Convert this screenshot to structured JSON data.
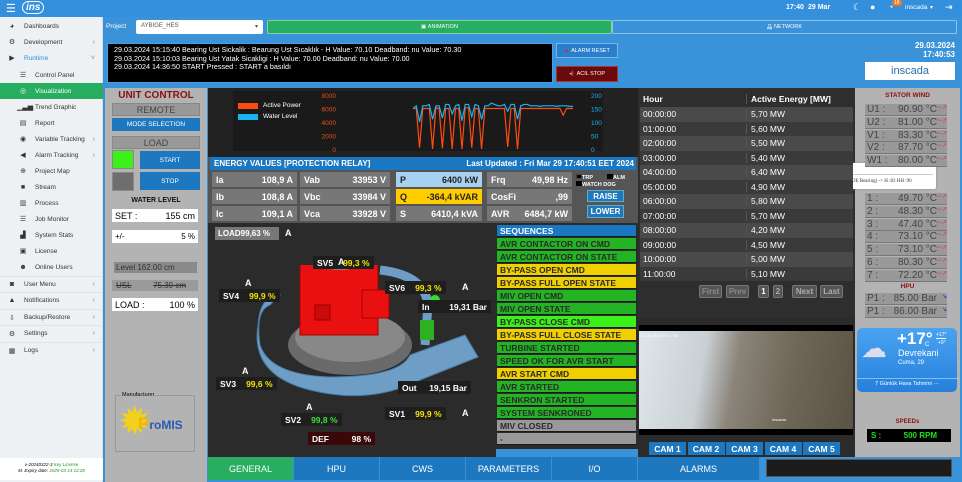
{
  "topbar": {
    "time": "17:40",
    "date": "29 Mar",
    "notif_count": "18",
    "user": "inscada"
  },
  "sidebar": {
    "items": [
      {
        "label": "Dashboards",
        "icon": "dashboard-icon",
        "glyph": "◕"
      },
      {
        "label": "Development",
        "icon": "development-icon",
        "glyph": "⚙",
        "chev": "‹"
      },
      {
        "label": "Runtime",
        "icon": "runtime-icon",
        "glyph": "▶",
        "chev": "˅"
      },
      {
        "label": "Control Panel",
        "icon": "control-panel-icon",
        "glyph": "☰",
        "sub": true
      },
      {
        "label": "Visualization",
        "icon": "visualization-icon",
        "glyph": "◎",
        "sub": true,
        "active": true
      },
      {
        "label": "Trend Graphic",
        "icon": "trend-icon",
        "glyph": "▁▃▅",
        "sub": true
      },
      {
        "label": "Report",
        "icon": "report-icon",
        "glyph": "▤",
        "sub": true
      },
      {
        "label": "Variable Tracking",
        "icon": "eye-icon",
        "glyph": "◉",
        "sub": true,
        "chev": "‹"
      },
      {
        "label": "Alarm Tracking",
        "icon": "megaphone-icon",
        "glyph": "◀",
        "sub": true,
        "chev": "‹"
      },
      {
        "label": "Project Map",
        "icon": "globe-icon",
        "glyph": "⊕",
        "sub": true
      },
      {
        "label": "Stream",
        "icon": "video-icon",
        "glyph": "■",
        "sub": true
      },
      {
        "label": "Process",
        "icon": "process-icon",
        "glyph": "▥",
        "sub": true
      },
      {
        "label": "Job Monitor",
        "icon": "job-monitor-icon",
        "glyph": "☰",
        "sub": true
      },
      {
        "label": "System Stats",
        "icon": "stats-icon",
        "glyph": "▟",
        "sub": true
      },
      {
        "label": "License",
        "icon": "license-icon",
        "glyph": "▣",
        "sub": true
      },
      {
        "label": "Online Users",
        "icon": "users-icon",
        "glyph": "☻",
        "sub": true
      },
      {
        "label": "User Menu",
        "icon": "user-icon",
        "glyph": "◙",
        "chev": "‹"
      },
      {
        "label": "Notifications",
        "icon": "bell-icon",
        "glyph": "▲",
        "chev": "‹"
      },
      {
        "label": "Backup/Restore",
        "icon": "download-icon",
        "glyph": "⇩",
        "chev": "‹"
      },
      {
        "label": "Settings",
        "icon": "gears-icon",
        "glyph": "⚙",
        "chev": "‹"
      },
      {
        "label": "Logs",
        "icon": "book-icon",
        "glyph": "▦",
        "chev": "‹"
      }
    ],
    "footer": {
      "version": "v-20240322-3",
      "key": "Key License",
      "expiry_label": "M. Expiry date:",
      "expiry": "2025-03-14 12:28"
    }
  },
  "project": {
    "label": "Project",
    "value": "AYBIGE_HES",
    "animation": "ANIMATION",
    "network": "NETWORK"
  },
  "alarms": {
    "lines": [
      "29.03.2024 15:15:40 Bearing Ust Sickalik : Bearung Ust Sıcaklık - H Value: 70.10  Deadband: nu  Value: 70.30",
      "29.03.2024 15:10:03 Bearing Ust Yatak Sicakligi : H Value: 70.00  Deadband: nu  Value: 70.00",
      "29.03.2024 14:36:50 START Pressed : START a basıldı"
    ],
    "reset": "ALARM RESET",
    "stop": "ACIL STOP"
  },
  "clock": {
    "date": "29.03.2024",
    "time": "17:40:53",
    "logo": "inscada"
  },
  "unit_control": {
    "title": "UNIT CONTROL",
    "remote": "REMOTE",
    "mode": "MODE SELECTION",
    "load": "LOAD",
    "start": "START",
    "stop": "STOP",
    "water_title": "WATER LEVEL",
    "set_label": "SET :",
    "set_value": "155 cm",
    "pm_label": "+/-",
    "pm_value": "5 %",
    "level": "Level 162.00  cm",
    "usl_label": "USL",
    "usl_value": "75.39 cm",
    "load_label": "LOAD :",
    "load_value": "100 %",
    "manufacturer": "Manufacturer",
    "maker_logo": "ProMIS"
  },
  "trend": {
    "legend": [
      "Active Power",
      "Water Level"
    ],
    "colors": [
      "#ff4a10",
      "#1ab4f0"
    ],
    "left_ticks": [
      "8000",
      "6000",
      "4000",
      "2000",
      "0"
    ],
    "right_ticks": [
      "200",
      "150",
      "100",
      "50",
      "0"
    ],
    "active_power": [
      6000,
      6000,
      200,
      6000,
      6000,
      6000,
      0,
      6100,
      6000,
      100,
      6000,
      6000,
      0,
      6000,
      6000,
      0,
      6100,
      6100,
      200,
      6000,
      6000,
      0,
      6000,
      6000,
      6000,
      6000,
      6000,
      6000,
      6000,
      300,
      6000,
      6000,
      0,
      6000,
      6000,
      6000,
      6000,
      6000,
      6000,
      6000,
      6000,
      6000,
      6000,
      6000,
      6000,
      6000,
      5000,
      6000,
      6000,
      6000
    ],
    "water_level": [
      150,
      160,
      100,
      160,
      160,
      165,
      110,
      160,
      160,
      115,
      165,
      165,
      130,
      160,
      165,
      105,
      165,
      165,
      120,
      165,
      160,
      110,
      160,
      160,
      170,
      165,
      160,
      160,
      165,
      140,
      165,
      165,
      110,
      160,
      165,
      165,
      160,
      160,
      160,
      158,
      160,
      160,
      160,
      160,
      158,
      160,
      160,
      160,
      158,
      158
    ]
  },
  "energy": {
    "title": "ENERGY VALUES [PROTECTION  RELAY]",
    "updated": "Last Updated : Fri Mar 29 17:40:51 EET 2024",
    "cols": [
      [
        [
          "Ia",
          "108,9 A"
        ],
        [
          "Ib",
          "108,8 A"
        ],
        [
          "Ic",
          "109,1 A"
        ]
      ],
      [
        [
          "Vab",
          "33953 V"
        ],
        [
          "Vbc",
          "33984 V"
        ],
        [
          "Vca",
          "33928 V"
        ]
      ],
      [
        [
          "P",
          "6400 kW"
        ],
        [
          "Q",
          "-364,4 kVAR"
        ],
        [
          "S",
          "6410,4 kVA"
        ]
      ],
      [
        [
          "Frq",
          "49,98 Hz"
        ],
        [
          "CosFi",
          ",99"
        ],
        [
          "AVR",
          "6484,7 kW"
        ]
      ]
    ],
    "trp": "TRP",
    "alm": "ALM",
    "watchdog": "WATCH DOG",
    "raise": "RAISE",
    "lower": "LOWER"
  },
  "turbine": {
    "load": "LOAD99,63 %",
    "load_mode": "A",
    "mode": "A",
    "valves": [
      {
        "name": "SV5",
        "value": "99,3 %"
      },
      {
        "name": "SV6",
        "value": "99,3 %"
      },
      {
        "name": "SV4",
        "value": "99,9 %"
      },
      {
        "name": "SV3",
        "value": "99,6 %"
      },
      {
        "name": "SV2",
        "value": "99,8 %"
      },
      {
        "name": "SV1",
        "value": "99,9 %"
      }
    ],
    "in_label": "In",
    "in_value": "19,31 Bar",
    "out_label": "Out",
    "out_value": "19,15 Bar",
    "def_label": "DEF",
    "def_value": "98 %"
  },
  "sequences": {
    "title": "SEQUENCES",
    "items": [
      {
        "label": "AVR CONTACTOR ON CMD",
        "color": "#22b422"
      },
      {
        "label": "AVR CONTACTOR ON STATE",
        "color": "#22b422"
      },
      {
        "label": "BY-PASS OPEN CMD",
        "color": "#f0d000"
      },
      {
        "label": "BY-PASS FULL OPEN STATE",
        "color": "#f0d000"
      },
      {
        "label": "MIV OPEN CMD",
        "color": "#22b422"
      },
      {
        "label": "MIV OPEN STATE",
        "color": "#22b422"
      },
      {
        "label": "BY-PASS CLOSE CMD",
        "color": "#3cf01a"
      },
      {
        "label": "BY-PASS FULL CLOSE STATE",
        "color": "#f0d000"
      },
      {
        "label": "TURBINE STARTED",
        "color": "#22b422"
      },
      {
        "label": "SPEED OK FOR AVR START",
        "color": "#22b422"
      },
      {
        "label": "AVR START CMD",
        "color": "#f0d000"
      },
      {
        "label": "AVR STARTED",
        "color": "#22b422"
      },
      {
        "label": "SENKRON STARTED",
        "color": "#22b422"
      },
      {
        "label": "SYSTEM SENKRONED",
        "color": "#22b422"
      },
      {
        "label": "MIV CLOSED",
        "color": "#999999"
      },
      {
        "label": "-",
        "color": "#999999"
      }
    ]
  },
  "energy_table": {
    "headers": [
      "Hour",
      "Active Energy [MW]"
    ],
    "rows": [
      [
        "00:00:00",
        "5,70 MW"
      ],
      [
        "01:00:00",
        "5,60 MW"
      ],
      [
        "02:00:00",
        "5,50 MW"
      ],
      [
        "03:00:00",
        "5,40 MW"
      ],
      [
        "04:00:00",
        "6,40 MW"
      ],
      [
        "05:00:00",
        "4,90 MW"
      ],
      [
        "06:00:00",
        "5,80 MW"
      ],
      [
        "07:00:00",
        "5,70 MW"
      ],
      [
        "08:00:00",
        "4,20 MW"
      ],
      [
        "09:00:00",
        "4,50 MW"
      ],
      [
        "10:00:00",
        "5,00 MW"
      ],
      [
        "11:00:00",
        "5,10 MW"
      ]
    ],
    "pager": {
      "first": "First",
      "prev": "Prev",
      "p1": "1",
      "p2": "2",
      "next": "Next",
      "last": "Last"
    }
  },
  "tooltip": {
    "title": "Description",
    "text": "Alt Yatak Sıcaklığı (DE Bearing) -> H :83 HH :90"
  },
  "camera": {
    "watermark": "inscada",
    "overlay": "03-29-2024 Fri 17:40",
    "buttons": [
      "CAM 1",
      "CAM 2",
      "CAM 3",
      "CAM 4",
      "CAM 5"
    ]
  },
  "stator": {
    "title": "STATOR WIND",
    "rows": [
      [
        "U1 :",
        "90.90 °C"
      ],
      [
        "U2 :",
        "81.00 °C"
      ],
      [
        "V1 :",
        "83.30 °C"
      ],
      [
        "V2 :",
        "87.70 °C"
      ],
      [
        "W1 :",
        "80.00 °C"
      ],
      [
        "W2 :",
        ""
      ]
    ]
  },
  "bearing": {
    "rows": [
      [
        "1 :",
        "49.70 °C"
      ],
      [
        "2 :",
        "48.30 °C"
      ],
      [
        "3 :",
        "47.40 °C"
      ],
      [
        "4 :",
        "73.10 °C"
      ],
      [
        "5 :",
        "73.10 °C"
      ],
      [
        "6 :",
        "80.30 °C"
      ],
      [
        "7 :",
        "72.20 °C"
      ]
    ]
  },
  "hpu": {
    "title": "HPU",
    "rows": [
      [
        "P1 :",
        "85.00 Bar"
      ],
      [
        "P1 :",
        "86.00 Bar"
      ]
    ]
  },
  "weather": {
    "temp": "+17°",
    "unit": "C",
    "high": "+17°",
    "low": "+9°",
    "city": "Devrekani",
    "day": "Cuma, 29",
    "forecast": "7 Günlük Hava Tahmini ···"
  },
  "speeds": {
    "title": "SPEEDs",
    "label": "S :",
    "value": "500 RPM"
  },
  "tabs": [
    "GENERAL",
    "HPU",
    "CWS",
    "PARAMETERS",
    "I/O",
    "ALARMS"
  ]
}
